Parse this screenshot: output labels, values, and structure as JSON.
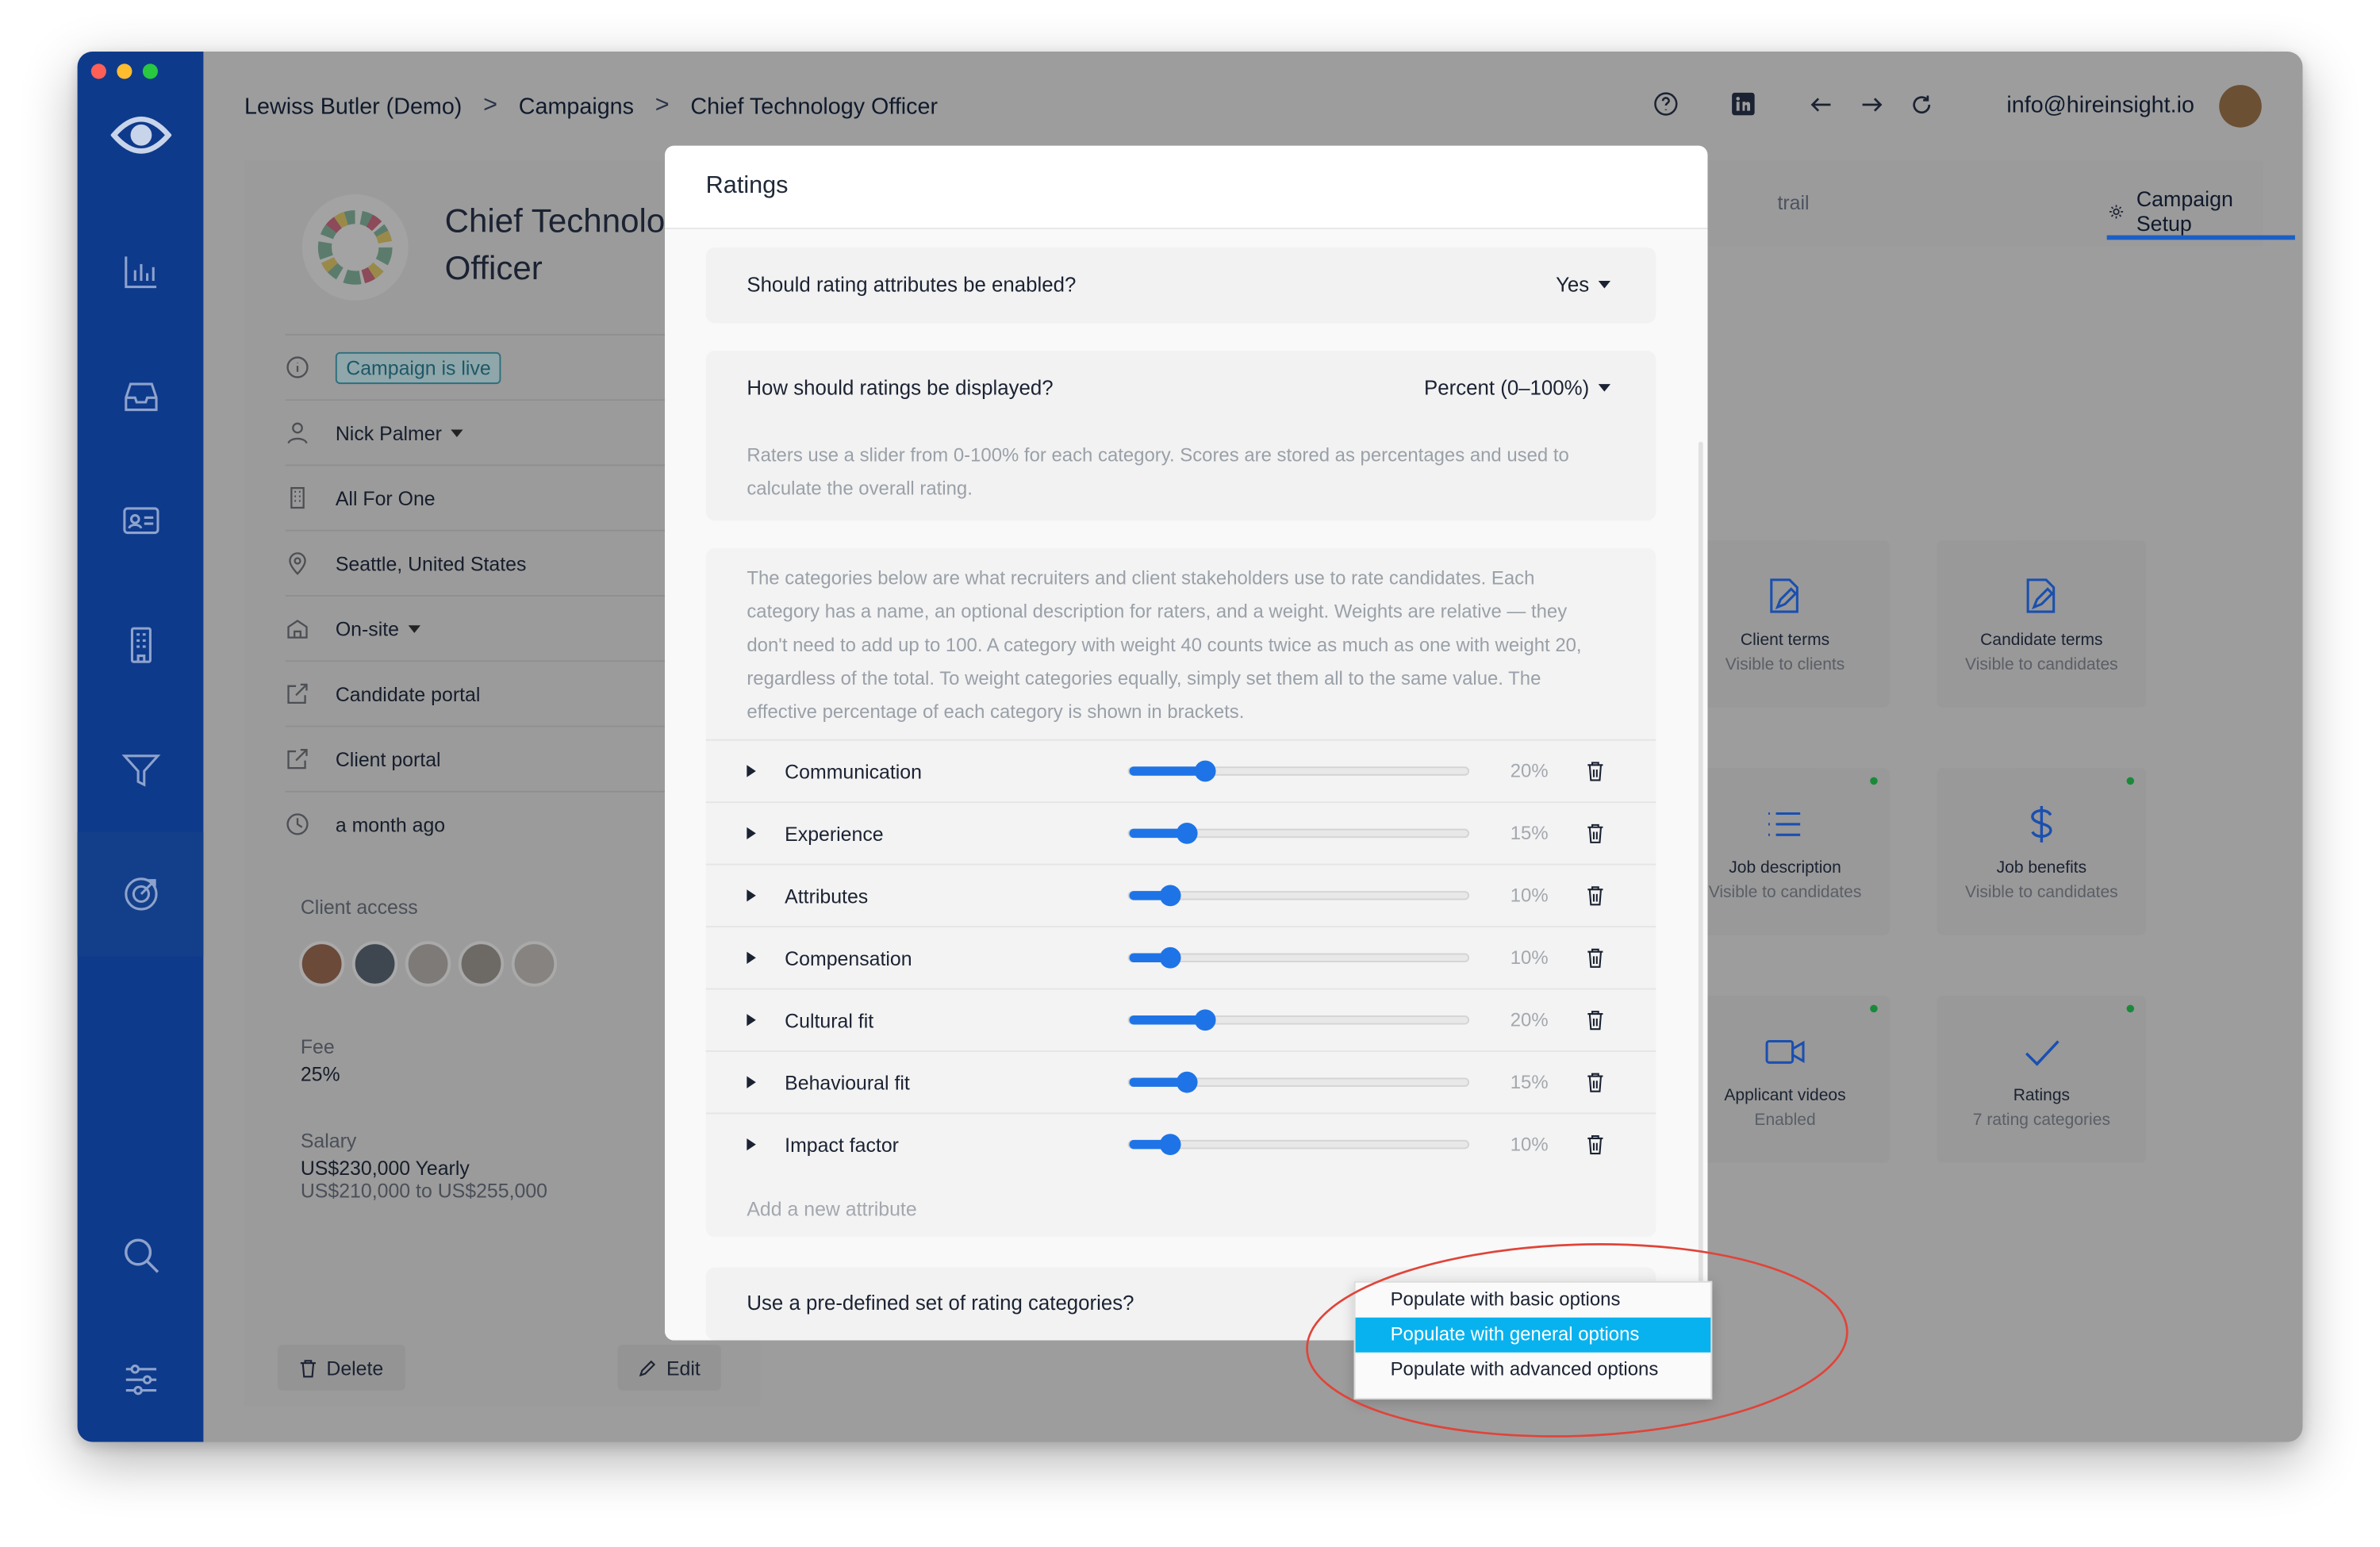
{
  "window": {
    "traffic_lights": [
      "close",
      "minimize",
      "zoom"
    ]
  },
  "sidebar": {
    "items": [
      {
        "icon": "bar-chart-icon"
      },
      {
        "icon": "inbox-icon"
      },
      {
        "icon": "contact-card-icon"
      },
      {
        "icon": "building-icon"
      },
      {
        "icon": "filter-icon"
      },
      {
        "icon": "target-icon",
        "active": true
      },
      {
        "icon": "search-icon"
      },
      {
        "icon": "sliders-icon"
      }
    ]
  },
  "topbar": {
    "breadcrumb": [
      "Lewiss Butler (Demo)",
      "Campaigns",
      "Chief Technology Officer"
    ],
    "separator": ">",
    "icons": [
      "help-icon",
      "linkedin-icon",
      "back-icon",
      "forward-icon",
      "refresh-icon"
    ],
    "email": "info@hireinsight.io"
  },
  "campaign": {
    "title": "Chief Technology Officer",
    "status": "Campaign is live",
    "owner": "Nick Palmer",
    "client": "All For One",
    "location": "Seattle, United States",
    "work_mode": "On-site",
    "candidate_portal": "Candidate portal",
    "client_portal": "Client portal",
    "updated": "a month ago",
    "client_access_label": "Client access",
    "fee_label": "Fee",
    "fee_value": "25%",
    "salary_label": "Salary",
    "salary_value": "US$230,000 Yearly",
    "salary_range": "US$210,000 to US$255,000",
    "delete_label": "Delete",
    "edit_label": "Edit"
  },
  "right_panel": {
    "tab_partial": "trail",
    "tab_setup": "Campaign Setup",
    "tiles": [
      {
        "title": "Client terms",
        "subtitle": "Visible to clients",
        "icon": "edit-document-icon",
        "dot": false
      },
      {
        "title": "Candidate terms",
        "subtitle": "Visible to candidates",
        "icon": "edit-document-icon",
        "dot": false
      },
      {
        "title": "Job description",
        "subtitle": "Visible to candidates",
        "icon": "list-icon",
        "dot": true
      },
      {
        "title": "Job benefits",
        "subtitle": "Visible to candidates",
        "icon": "dollar-icon",
        "dot": true
      },
      {
        "title": "Applicant videos",
        "subtitle": "Enabled",
        "icon": "video-icon",
        "dot": true
      },
      {
        "title": "Ratings",
        "subtitle": "7 rating categories",
        "icon": "check-icon",
        "dot": true
      }
    ]
  },
  "modal": {
    "title": "Ratings",
    "q_enabled": {
      "label": "Should rating attributes be enabled?",
      "value": "Yes"
    },
    "q_display": {
      "label": "How should ratings be displayed?",
      "value": "Percent (0–100%)",
      "help": "Raters use a slider from 0-100% for each category. Scores are stored as percentages and used to calculate the overall rating."
    },
    "categories_help": "The categories below are what recruiters and client stakeholders use to rate candidates. Each category has a name, an optional description for raters, and a weight. Weights are relative — they don't need to add up to 100. A category with weight 40 counts twice as much as one with weight 20, regardless of the total. To weight categories equally, simply set them all to the same value. The effective percentage of each category is shown in brackets.",
    "attributes": [
      {
        "name": "Communication",
        "percent": "20%",
        "level": 0.22
      },
      {
        "name": "Experience",
        "percent": "15%",
        "level": 0.17
      },
      {
        "name": "Attributes",
        "percent": "10%",
        "level": 0.12
      },
      {
        "name": "Compensation",
        "percent": "10%",
        "level": 0.12
      },
      {
        "name": "Cultural fit",
        "percent": "20%",
        "level": 0.22
      },
      {
        "name": "Behavioural fit",
        "percent": "15%",
        "level": 0.17
      },
      {
        "name": "Impact factor",
        "percent": "10%",
        "level": 0.12
      }
    ],
    "add_placeholder": "Add a new attribute",
    "q_predefined": {
      "label": "Use a pre-defined set of rating categories?"
    }
  },
  "dropdown": {
    "options": [
      "Populate with basic options",
      "Populate with general options",
      "Populate with advanced options"
    ],
    "selected_index": 1
  },
  "colors": {
    "accent": "#1e74e6",
    "sidebar": "#0e3a8c",
    "selected": "#08b2ee",
    "annotation": "#e0443a"
  }
}
